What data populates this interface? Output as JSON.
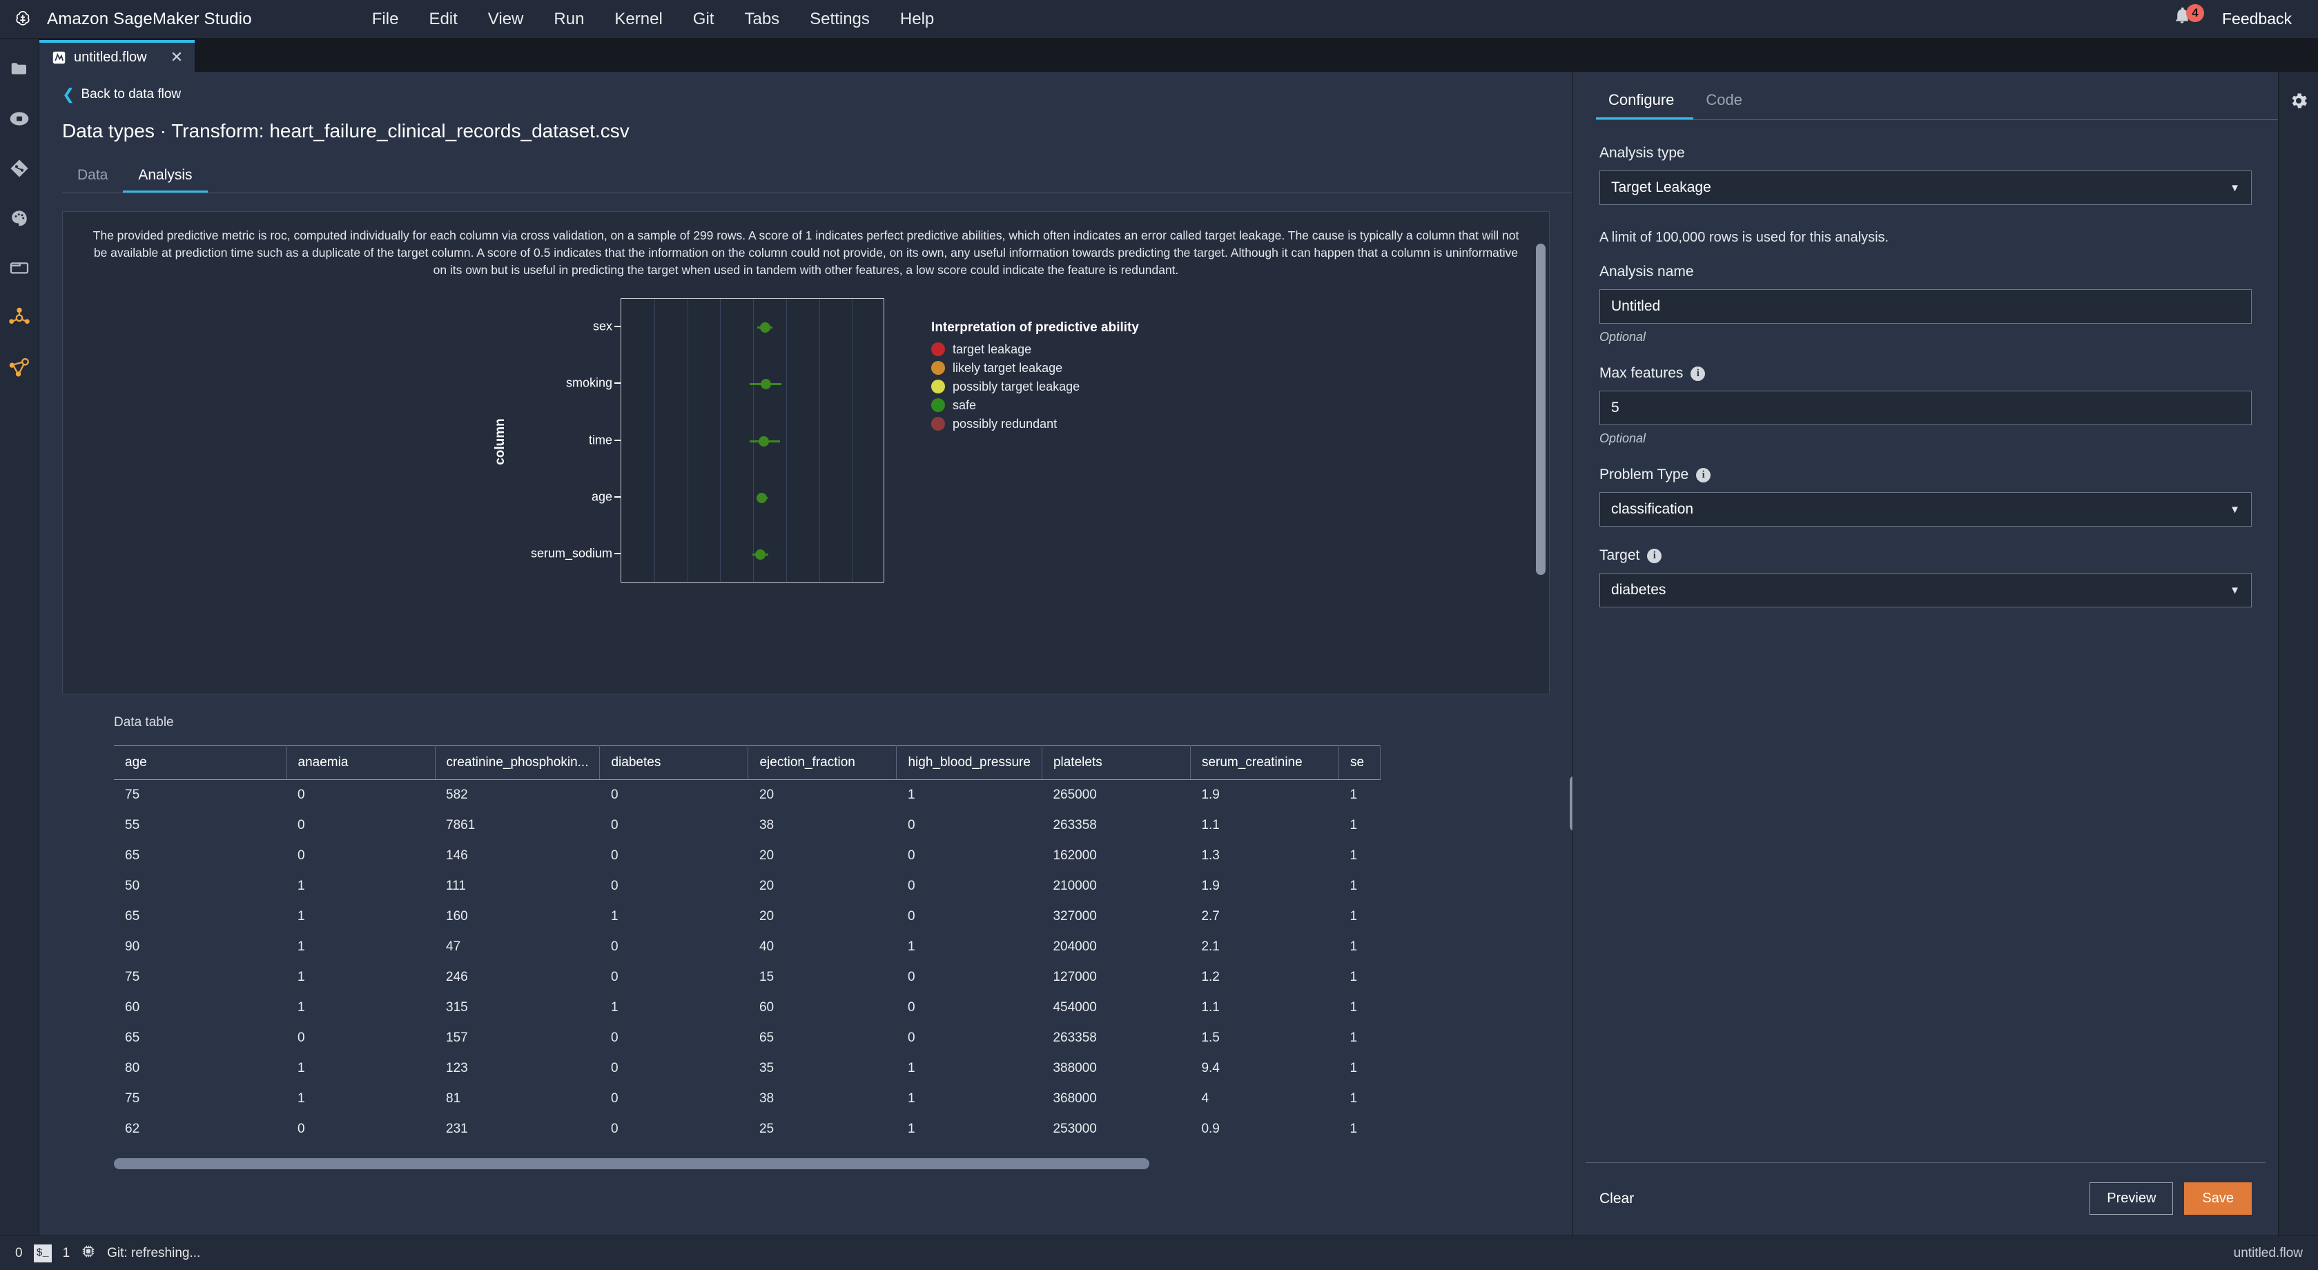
{
  "app": {
    "title": "Amazon SageMaker Studio",
    "logo_icon": "sagemaker-logo-icon",
    "menu": [
      "File",
      "Edit",
      "View",
      "Run",
      "Kernel",
      "Git",
      "Tabs",
      "Settings",
      "Help"
    ],
    "notification_badge": "4",
    "notification_icon": "bell-icon",
    "feedback_label": "Feedback"
  },
  "rail": {
    "items": [
      {
        "name": "file-browser-icon",
        "icon": "folder-icon"
      },
      {
        "name": "running-terminals-icon",
        "icon": "stop-circle-icon"
      },
      {
        "name": "git-icon",
        "icon": "git-diamond-icon"
      },
      {
        "name": "extensions-icon",
        "icon": "palette-icon"
      },
      {
        "name": "open-tabs-icon",
        "icon": "tabs-icon"
      },
      {
        "name": "sagemaker-components-icon",
        "icon": "molecule-icon"
      },
      {
        "name": "sagemaker-pipelines-icon",
        "icon": "pipeline-icon"
      }
    ]
  },
  "tab": {
    "name": "untitled.flow",
    "icon": "flow-file-icon",
    "close_label": "✕"
  },
  "flow": {
    "back_label": "Back to data flow",
    "back_icon": "chevron-left-icon",
    "page_title": "Data types · Transform: heart_failure_clinical_records_dataset.csv",
    "subtabs": [
      {
        "label": "Data",
        "active": false
      },
      {
        "label": "Analysis",
        "active": true
      }
    ],
    "description": "The provided predictive metric is roc, computed individually for each column via cross validation, on a sample of 299 rows. A score of 1 indicates perfect predictive abilities, which often indicates an error called target leakage. The cause is typically a column that will not be available at prediction time such as a duplicate of the target column. A score of 0.5 indicates that the information on the column could not provide, on its own, any useful information towards predicting the target. Although it can happen that a column is uninformative on its own but is useful in predicting the target when used in tandem with other features, a low score could indicate the feature is redundant.",
    "data_table_title": "Data table"
  },
  "chart_data": {
    "type": "scatter",
    "title": "",
    "xlabel": "",
    "ylabel": "column",
    "categories": [
      "sex",
      "smoking",
      "time",
      "age",
      "serum_sodium"
    ],
    "values": [
      0.545,
      0.548,
      0.54,
      0.533,
      0.527
    ],
    "error_low": [
      0.515,
      0.488,
      0.487,
      0.513,
      0.497
    ],
    "error_high": [
      0.572,
      0.608,
      0.603,
      0.555,
      0.558
    ],
    "xlim": [
      0.0,
      1.0
    ],
    "grid": true,
    "point_color": "#3c8a1f",
    "gridlines": 7,
    "legend_position": "right",
    "legend_title": "Interpretation of predictive ability",
    "legend": [
      {
        "label": "target leakage",
        "color": "#c1272d"
      },
      {
        "label": "likely target leakage",
        "color": "#d08a2b"
      },
      {
        "label": "possibly target leakage",
        "color": "#d9d94a"
      },
      {
        "label": "safe",
        "color": "#2e8b1f"
      },
      {
        "label": "possibly redundant",
        "color": "#8d3b3b"
      }
    ]
  },
  "table": {
    "columns": [
      "age",
      "anaemia",
      "creatinine_phosphokin...",
      "diabetes",
      "ejection_fraction",
      "high_blood_pressure",
      "platelets",
      "serum_creatinine",
      "se"
    ],
    "rows": [
      [
        "75",
        "0",
        "582",
        "0",
        "20",
        "1",
        "265000",
        "1.9",
        "1"
      ],
      [
        "55",
        "0",
        "7861",
        "0",
        "38",
        "0",
        "263358",
        "1.1",
        "1"
      ],
      [
        "65",
        "0",
        "146",
        "0",
        "20",
        "0",
        "162000",
        "1.3",
        "1"
      ],
      [
        "50",
        "1",
        "111",
        "0",
        "20",
        "0",
        "210000",
        "1.9",
        "1"
      ],
      [
        "65",
        "1",
        "160",
        "1",
        "20",
        "0",
        "327000",
        "2.7",
        "1"
      ],
      [
        "90",
        "1",
        "47",
        "0",
        "40",
        "1",
        "204000",
        "2.1",
        "1"
      ],
      [
        "75",
        "1",
        "246",
        "0",
        "15",
        "0",
        "127000",
        "1.2",
        "1"
      ],
      [
        "60",
        "1",
        "315",
        "1",
        "60",
        "0",
        "454000",
        "1.1",
        "1"
      ],
      [
        "65",
        "0",
        "157",
        "0",
        "65",
        "0",
        "263358",
        "1.5",
        "1"
      ],
      [
        "80",
        "1",
        "123",
        "0",
        "35",
        "1",
        "388000",
        "9.4",
        "1"
      ],
      [
        "75",
        "1",
        "81",
        "0",
        "38",
        "1",
        "368000",
        "4",
        "1"
      ],
      [
        "62",
        "0",
        "231",
        "0",
        "25",
        "1",
        "253000",
        "0.9",
        "1"
      ]
    ]
  },
  "config": {
    "tabs": [
      {
        "label": "Configure",
        "active": true
      },
      {
        "label": "Code",
        "active": false
      }
    ],
    "analysis_type_label": "Analysis type",
    "analysis_type_value": "Target Leakage",
    "row_limit_note": "A limit of 100,000 rows is used for this analysis.",
    "analysis_name_label": "Analysis name",
    "analysis_name_value": "Untitled",
    "analysis_name_optional": "Optional",
    "max_features_label": "Max features",
    "max_features_value": "5",
    "max_features_optional": "Optional",
    "problem_type_label": "Problem Type",
    "problem_type_value": "classification",
    "target_label": "Target",
    "target_value": "diabetes",
    "clear_label": "Clear",
    "preview_label": "Preview",
    "save_label": "Save",
    "save_color": "#e07b39"
  },
  "status": {
    "left_count": "0",
    "terminal_icon": "terminal-icon",
    "kernel_count": "1",
    "kernel_icon": "cpu-chip-icon",
    "git_text": "Git: refreshing...",
    "right_text": "untitled.flow"
  },
  "settings_rail": {
    "icon": "gear-icon"
  }
}
